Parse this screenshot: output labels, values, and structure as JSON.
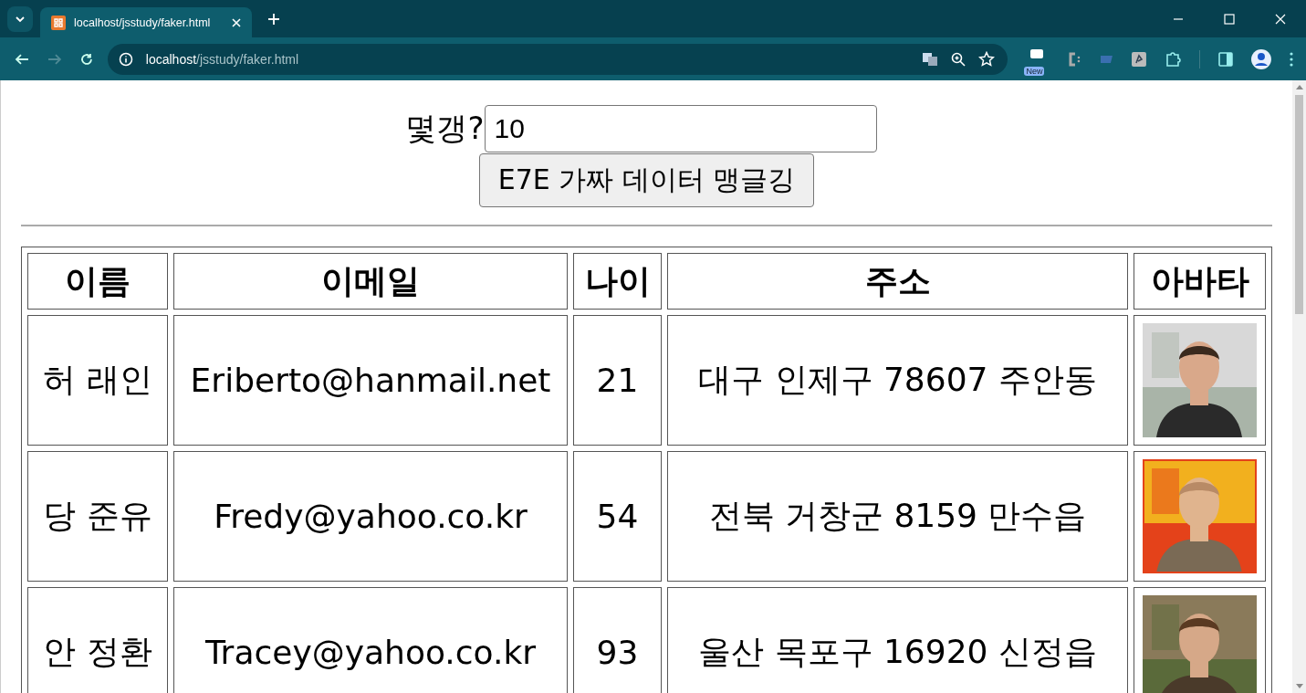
{
  "browser": {
    "tabs": [
      {
        "title": "localhost/jsstudy/faker.html",
        "selected": true
      }
    ],
    "address": {
      "host": "localhost",
      "path": "/jsstudy/faker.html"
    },
    "extension_badge": "New"
  },
  "form": {
    "label": "몇갱?",
    "count": {
      "value": "10"
    },
    "button": "E7E 가짜 데이터 맹글깅"
  },
  "table": {
    "columns": [
      "이름",
      "이메일",
      "나이",
      "주소",
      "아바타"
    ],
    "rows": [
      {
        "name": "허 래인",
        "email": "Eriberto@hanmail.net",
        "age": "21",
        "address": "대구 인제구 78607 주안동"
      },
      {
        "name": "당 준유",
        "email": "Fredy@yahoo.co.kr",
        "age": "54",
        "address": "전북 거창군 8159 만수읍"
      },
      {
        "name": "안 정환",
        "email": "Tracey@yahoo.co.kr",
        "age": "93",
        "address": "울산 목포구 16920 신정읍"
      }
    ]
  }
}
